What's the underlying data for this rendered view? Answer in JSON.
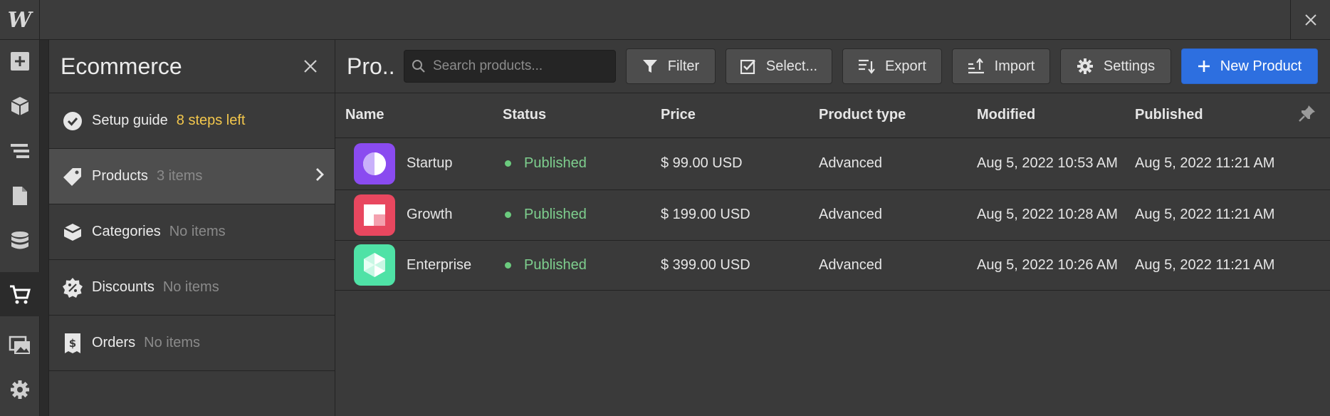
{
  "app": {
    "logo": "W"
  },
  "rail": {
    "items": [
      {
        "icon": "add-icon"
      },
      {
        "icon": "cube-icon"
      },
      {
        "icon": "navigator-icon"
      },
      {
        "icon": "pages-icon"
      },
      {
        "icon": "cms-database-icon"
      },
      {
        "icon": "ecommerce-cart-icon",
        "active": true
      },
      {
        "icon": "assets-icon"
      },
      {
        "icon": "settings-gear-icon"
      }
    ]
  },
  "panel": {
    "title": "Ecommerce",
    "items": [
      {
        "label": "Setup guide",
        "sub": "8 steps left",
        "icon": "check-circle-icon"
      },
      {
        "label": "Products",
        "sub": "3 items",
        "icon": "tag-icon"
      },
      {
        "label": "Categories",
        "sub": "No items",
        "icon": "categories-icon"
      },
      {
        "label": "Discounts",
        "sub": "No items",
        "icon": "discount-badge-icon"
      },
      {
        "label": "Orders",
        "sub": "No items",
        "icon": "receipt-icon"
      }
    ]
  },
  "main": {
    "title": "Pro..",
    "search_placeholder": "Search products...",
    "buttons": {
      "filter": "Filter",
      "select": "Select...",
      "export": "Export",
      "import": "Import",
      "settings": "Settings",
      "new_product": "New Product"
    },
    "columns": [
      "Name",
      "Status",
      "Price",
      "Product type",
      "Modified",
      "Published"
    ],
    "rows": [
      {
        "name": "Startup",
        "status": "Published",
        "price": "$ 99.00 USD",
        "type": "Advanced",
        "modified": "Aug 5, 2022 10:53 AM",
        "published": "Aug 5, 2022 11:21 AM",
        "thumb_color": "#8a4bf0"
      },
      {
        "name": "Growth",
        "status": "Published",
        "price": "$ 199.00 USD",
        "type": "Advanced",
        "modified": "Aug 5, 2022 10:28 AM",
        "published": "Aug 5, 2022 11:21 AM",
        "thumb_color": "#e8475f"
      },
      {
        "name": "Enterprise",
        "status": "Published",
        "price": "$ 399.00 USD",
        "type": "Advanced",
        "modified": "Aug 5, 2022 10:26 AM",
        "published": "Aug 5, 2022 11:21 AM",
        "thumb_color": "#4fe2a6"
      }
    ]
  },
  "colors": {
    "accent": "#2d6fe0",
    "published": "#7ecf8e",
    "warning": "#f3c74c"
  }
}
